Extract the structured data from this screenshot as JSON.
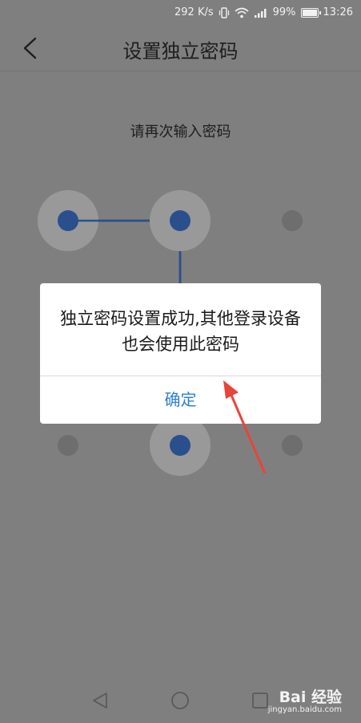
{
  "status_bar": {
    "net_speed": "292 K/s",
    "battery_percent": "99%",
    "battery_level": 0.99,
    "time": "13:26",
    "icons": [
      "vibrate-icon",
      "wifi-icon",
      "signal-icon",
      "battery-icon"
    ]
  },
  "header": {
    "title": "设置独立密码",
    "back_icon": "chevron-left-icon"
  },
  "prompt": "请再次输入密码",
  "pattern": {
    "selected_dots": [
      1,
      2,
      5,
      8
    ],
    "path_order": [
      1,
      2,
      5,
      8
    ],
    "line_color": "#2a4f8c",
    "dot_color": "#2a4f8c",
    "halo_color": "#999999",
    "idle_dot_color": "#6e6e6e"
  },
  "dialog": {
    "message": "独立密码设置成功,其他登录设备也会使用此密码",
    "confirm_label": "确定",
    "accent": "#2f7fd0"
  },
  "annotation": {
    "arrow_color": "#e8443a",
    "arrow_icon": "red-arrow-icon"
  },
  "nav_bar": {
    "icons": [
      "nav-back-icon",
      "nav-home-icon",
      "nav-recents-icon"
    ]
  },
  "watermark": {
    "logo_text": "Bai 经验",
    "url": "jingyan.baidu.com"
  }
}
